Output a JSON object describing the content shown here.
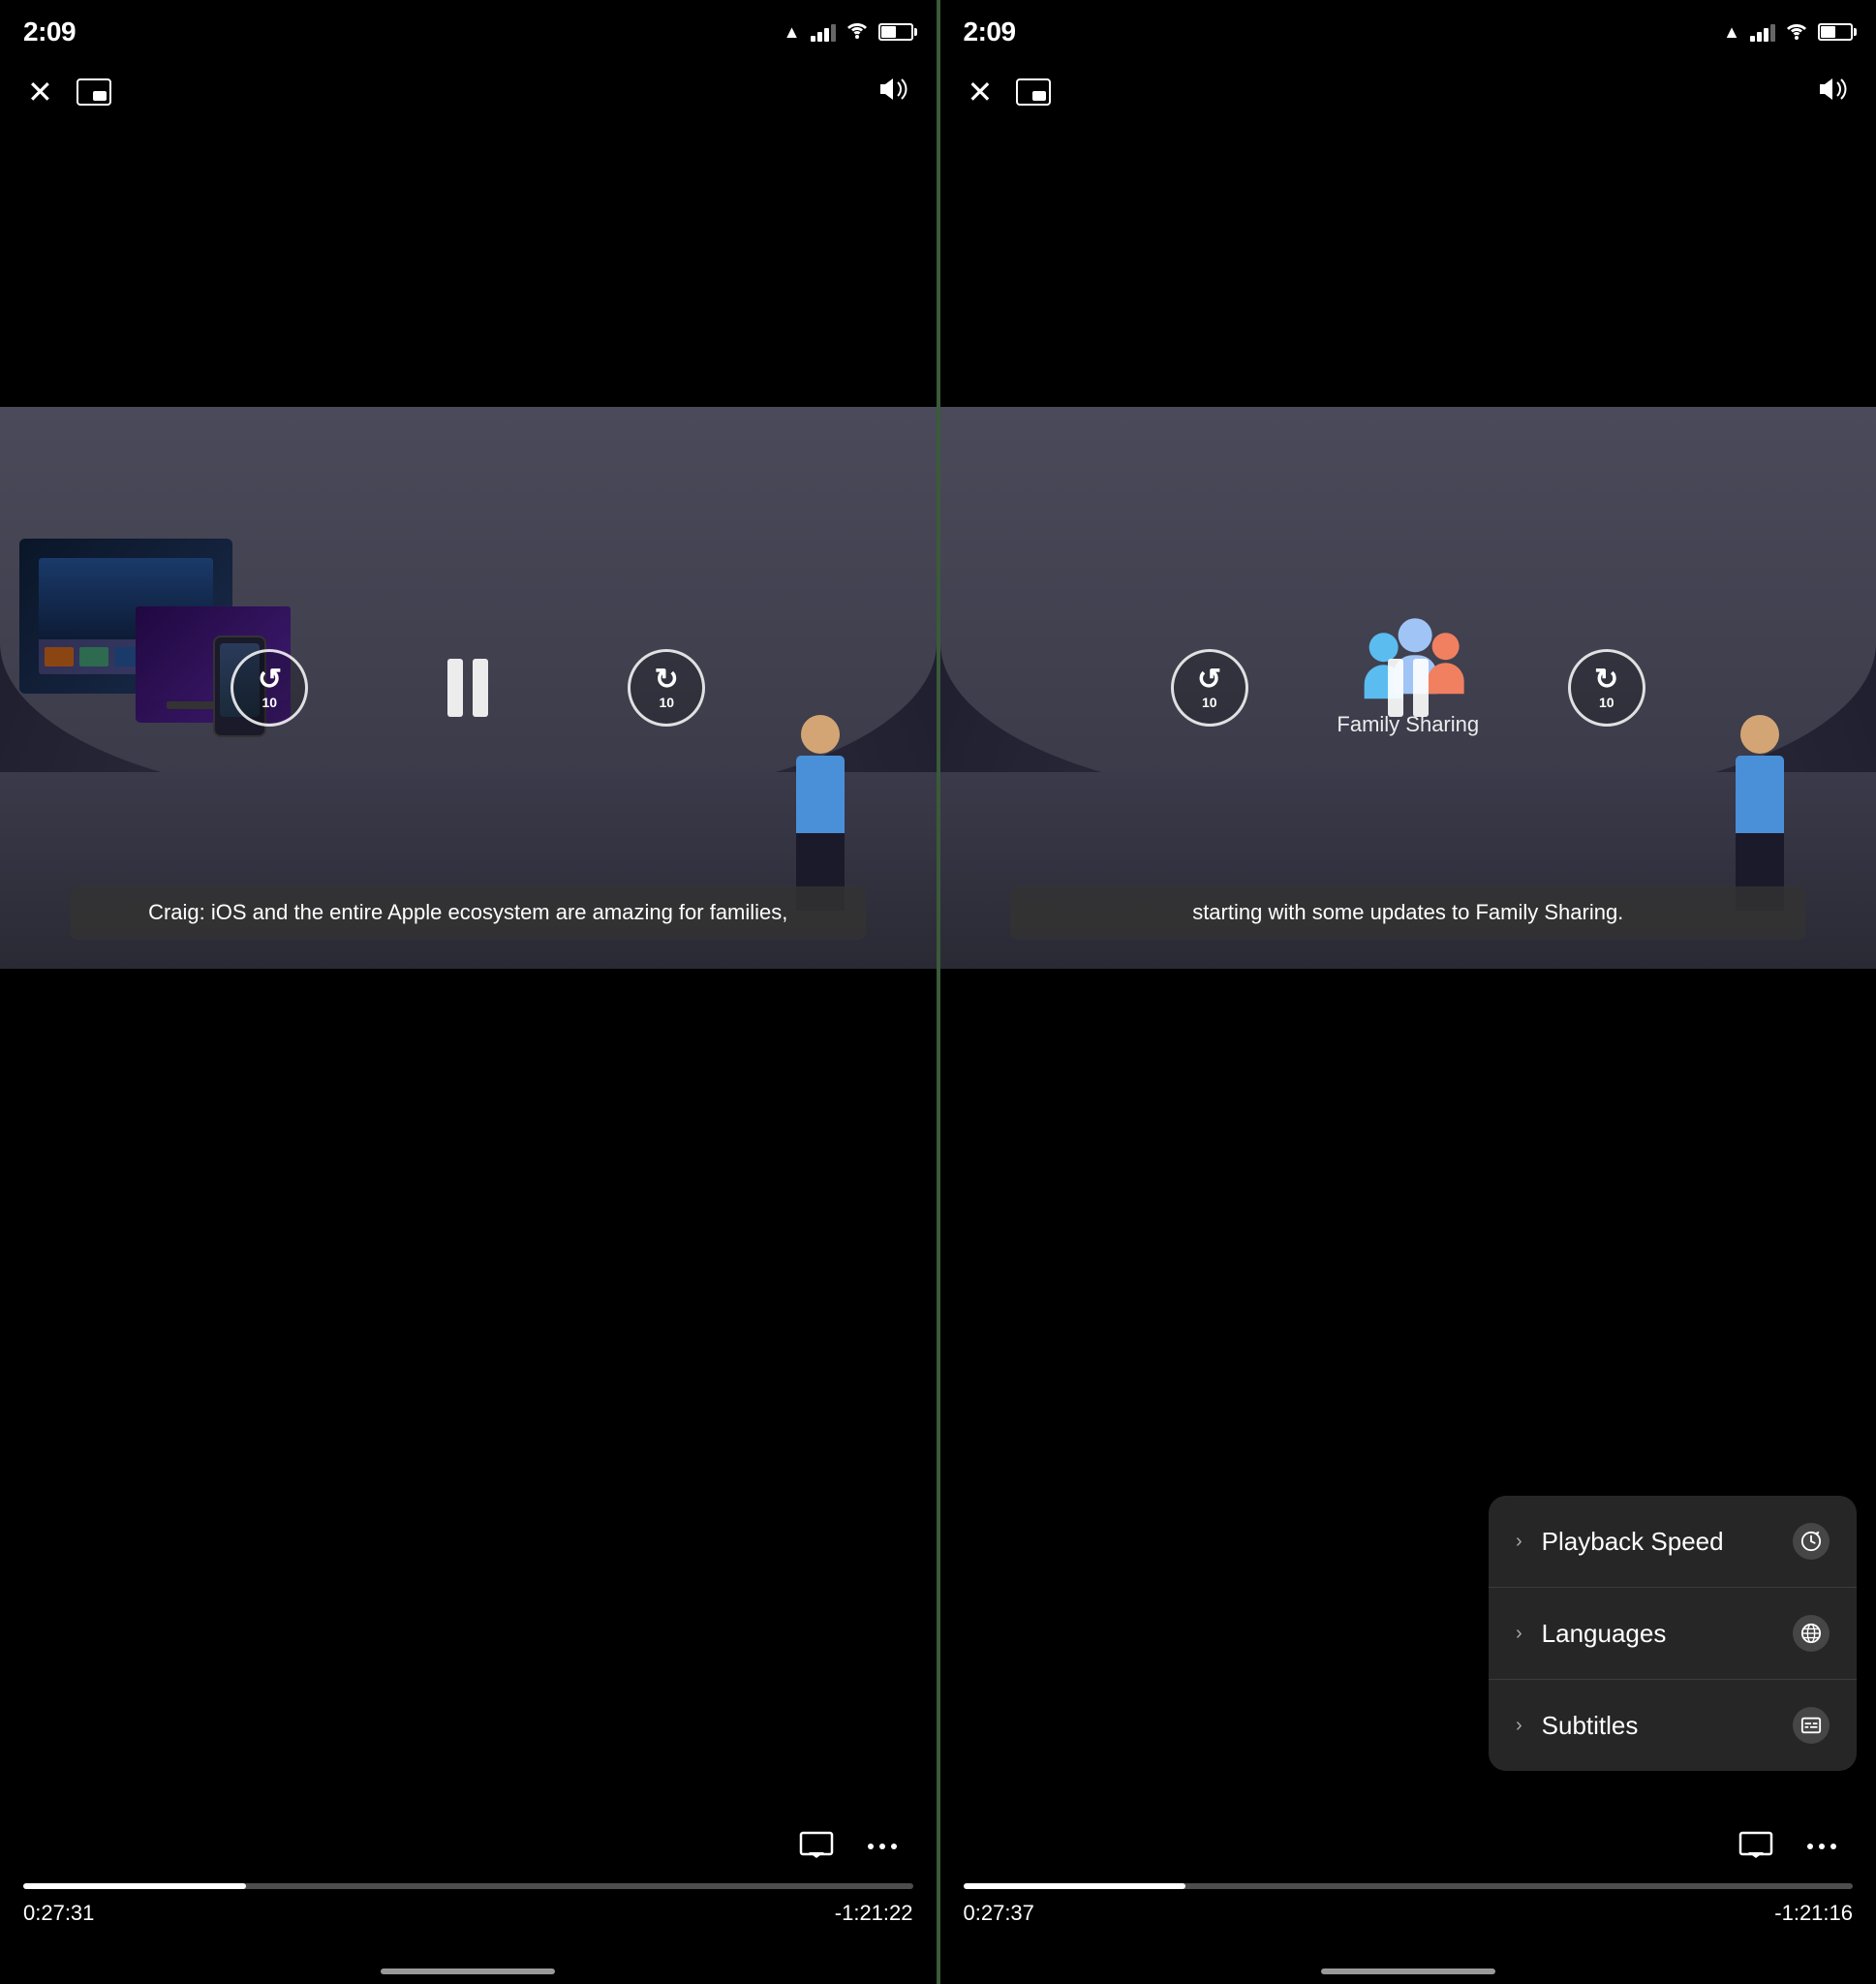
{
  "screens": [
    {
      "id": "left",
      "status_bar": {
        "time": "2:09",
        "has_location": true
      },
      "top_controls": {
        "close_label": "✕",
        "pip_label": "pip",
        "volume_label": "volume"
      },
      "video": {
        "subtitle": "Craig: iOS and the entire Apple ecosystem\nare amazing for families,",
        "has_pause": true,
        "rewind_seconds": "10",
        "forward_seconds": "10"
      },
      "bottom": {
        "progress_percent": 25,
        "time_elapsed": "0:27:31",
        "time_remaining": "-1:21:22"
      }
    },
    {
      "id": "right",
      "status_bar": {
        "time": "2:09",
        "has_location": true
      },
      "top_controls": {
        "close_label": "✕",
        "pip_label": "pip",
        "volume_label": "volume"
      },
      "video": {
        "subtitle": "starting with some updates\nto Family Sharing.",
        "has_pause": true,
        "rewind_seconds": "10",
        "forward_seconds": "10"
      },
      "context_menu": {
        "items": [
          {
            "label": "Playback Speed",
            "icon": "⏱",
            "chevron": "›"
          },
          {
            "label": "Languages",
            "icon": "🌐",
            "chevron": "›"
          },
          {
            "label": "Subtitles",
            "icon": "💬",
            "chevron": "›"
          }
        ]
      },
      "bottom": {
        "progress_percent": 25,
        "time_elapsed": "0:27:37",
        "time_remaining": "-1:21:16"
      }
    }
  ],
  "icons": {
    "close": "✕",
    "volume": "🔊",
    "airplay": "⊡",
    "more": "···"
  }
}
